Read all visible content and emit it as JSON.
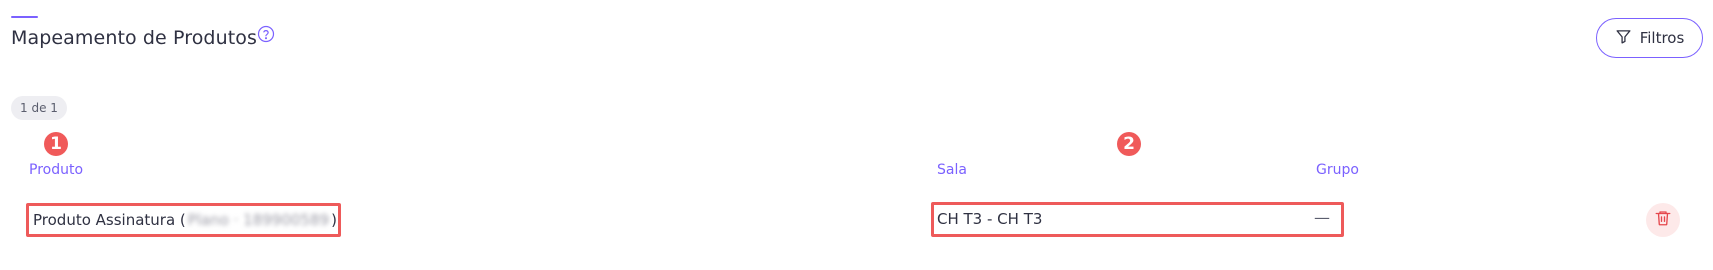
{
  "header": {
    "title": "Mapeamento de Produtos",
    "help_icon": "question-circle-icon",
    "filters_label": "Filtros",
    "filters_icon": "funnel-icon"
  },
  "pagination": {
    "count_label": "1 de 1"
  },
  "annotations": {
    "marker_1": "1",
    "marker_2": "2"
  },
  "table": {
    "columns": [
      "Produto",
      "Sala",
      "Grupo"
    ],
    "rows": [
      {
        "produto_prefix": "Produto Assinatura (",
        "produto_blurred": "Plano · 189900589",
        "produto_suffix": ")",
        "sala": "CH T3 - CH T3",
        "grupo": "—",
        "delete_icon": "trash-icon"
      }
    ]
  },
  "colors": {
    "accent": "#7b61ff",
    "highlight": "#ee5a5a",
    "delete_bg": "#fde9e9",
    "delete_icon": "#e5484d"
  }
}
